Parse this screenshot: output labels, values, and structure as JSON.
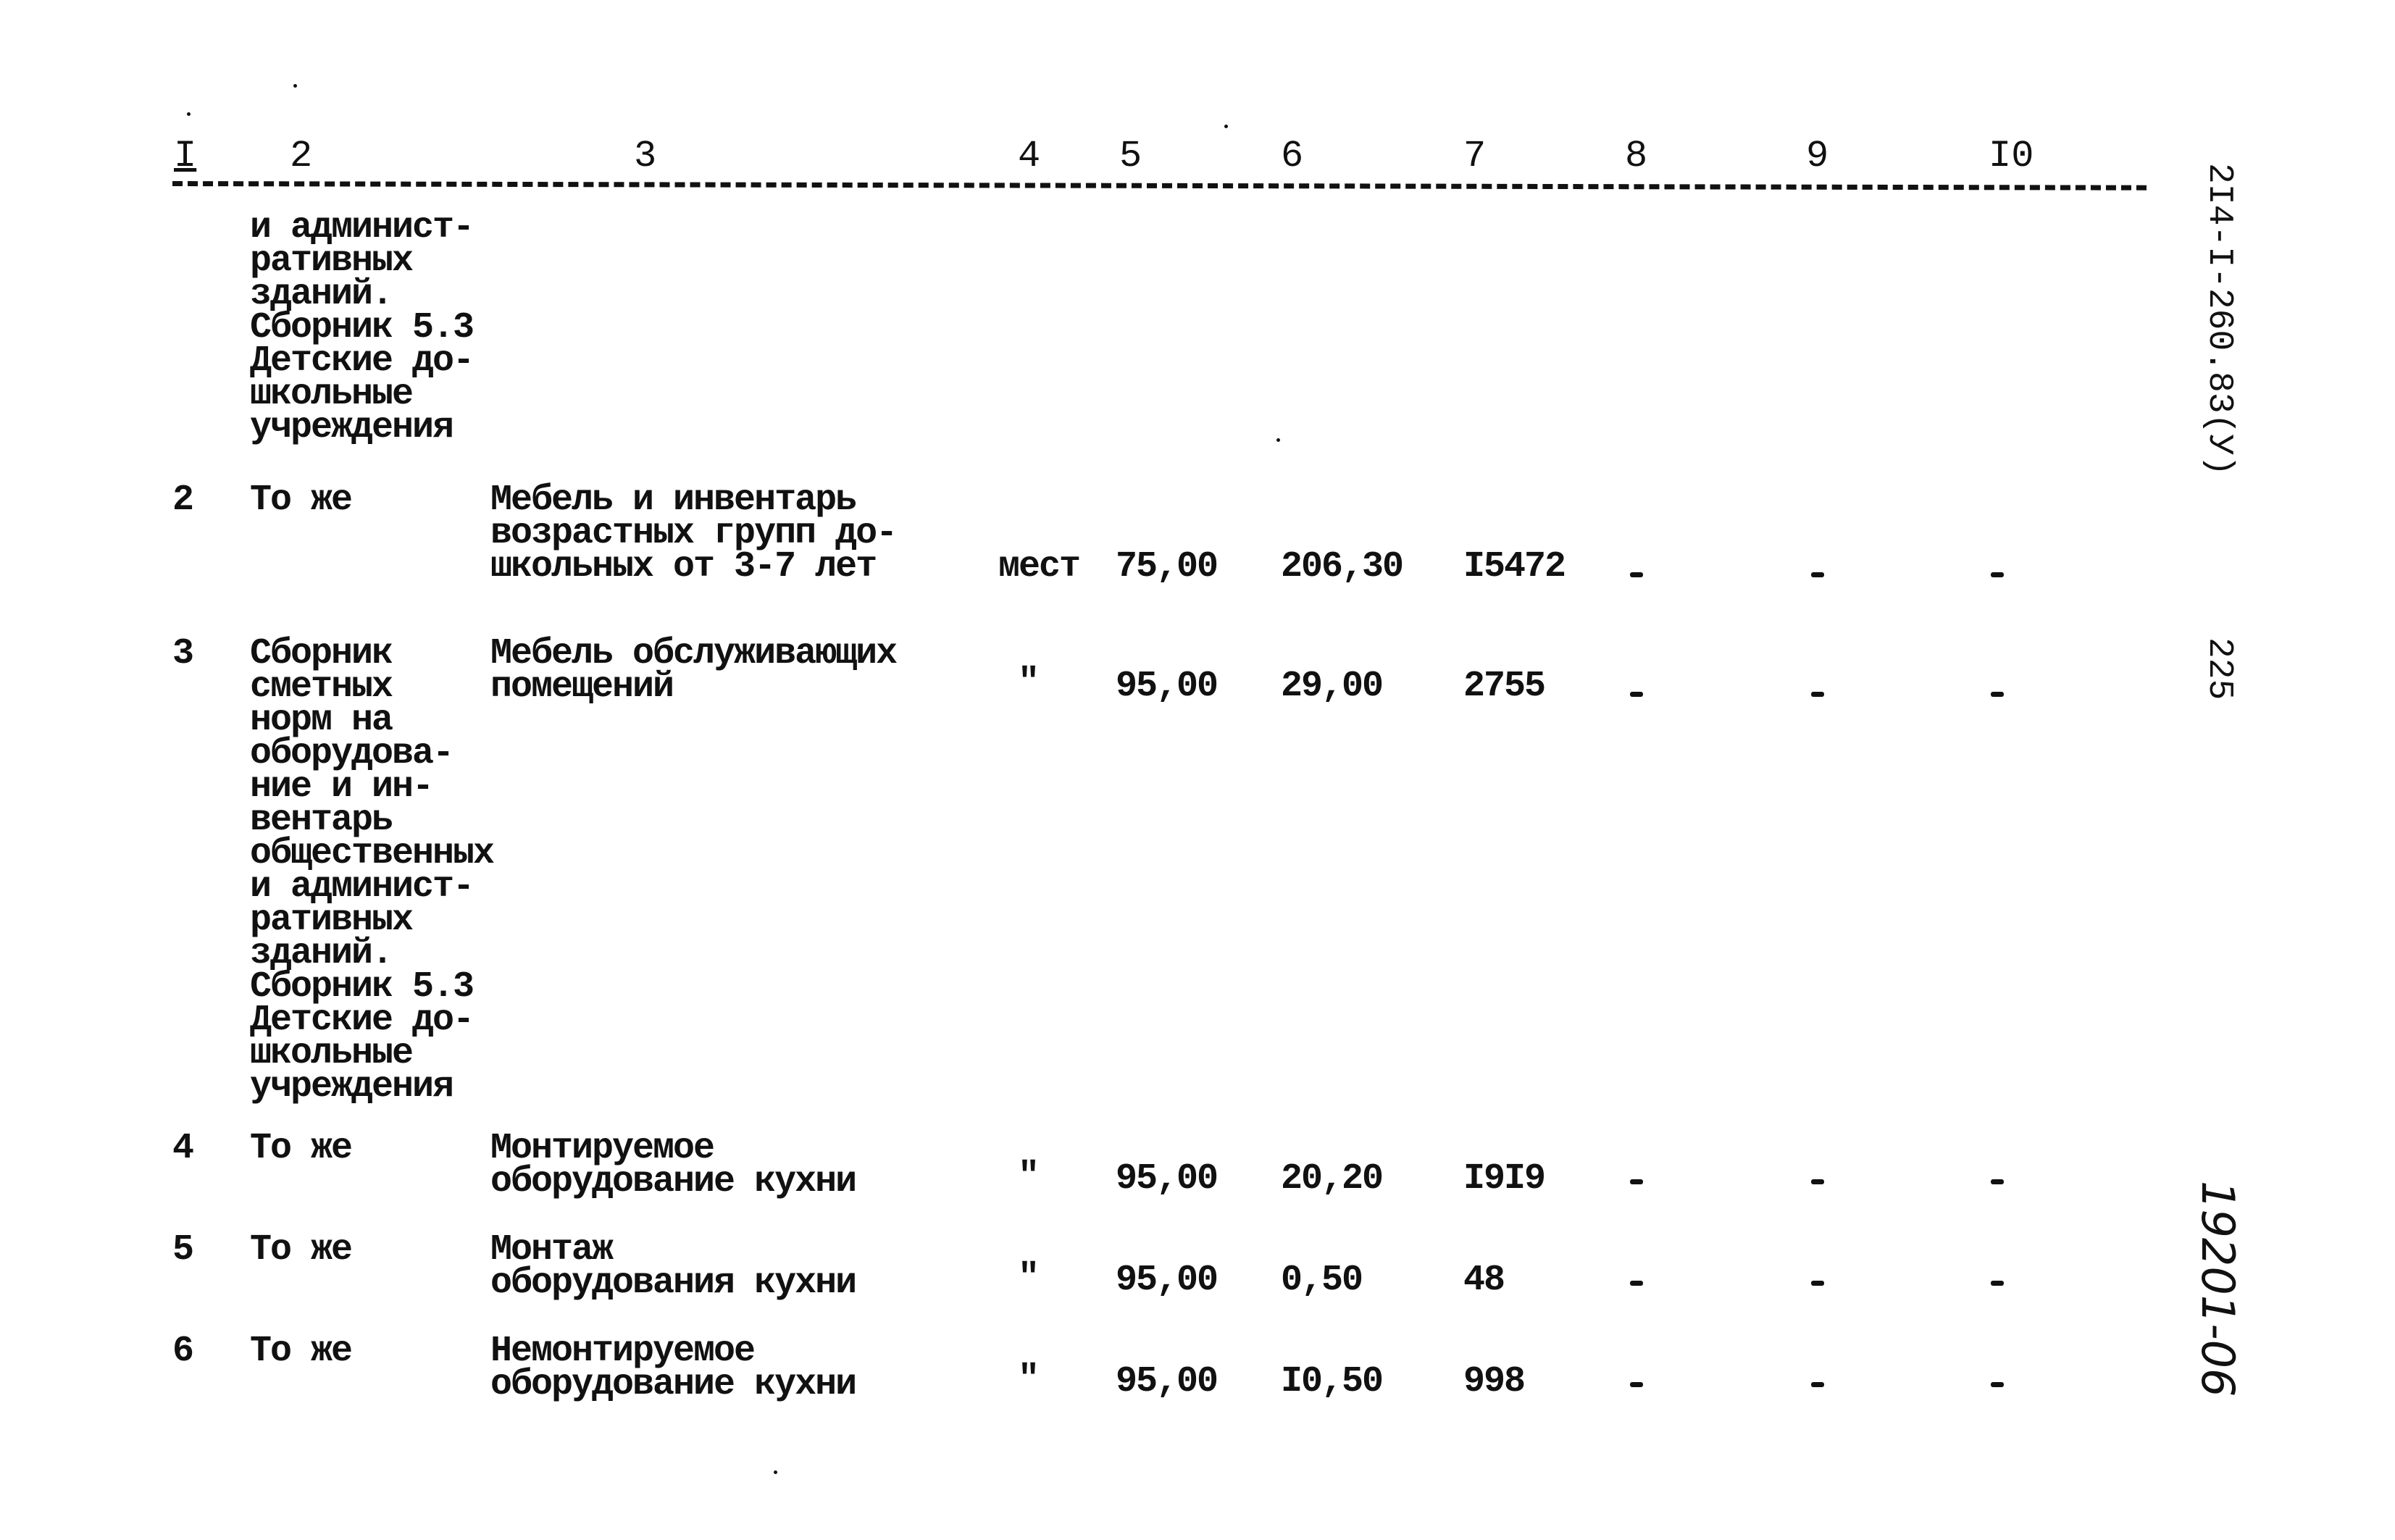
{
  "header": {
    "columns": [
      "I",
      "2",
      "3",
      "4",
      "5",
      "6",
      "7",
      "8",
      "9",
      "I0"
    ]
  },
  "margin": {
    "doc_code": "2I4-I-260.83(У)",
    "page_number": "225",
    "handwritten_code": "19201-06"
  },
  "rows": [
    {
      "num": "",
      "source": "и админист-\nративных\nзданий.\nСборник 5.3\nДетские до-\nшкольные\nучреждения",
      "name": "",
      "unit": "",
      "c5": "",
      "c6": "",
      "c7": "",
      "c8": "",
      "c9": "",
      "c10": ""
    },
    {
      "num": "2",
      "source": "То же",
      "name": "Мебель и инвентарь\nвозрастных групп до-\nшкольных от 3-7 лет",
      "unit": "мест",
      "c5": "75,00",
      "c6": "206,30",
      "c7": "I5472",
      "c8": "-",
      "c9": "-",
      "c10": "-"
    },
    {
      "num": "3",
      "source": "Сборник\nсметных\nнорм на\nоборудова-\nние и ин-\nвентарь\nобщественных\nи админист-\nративных\nзданий.\nСборник 5.3\nДетские до-\nшкольные\nучреждения",
      "name": "Мебель обслуживающих\nпомещений",
      "unit": "\"",
      "c5": "95,00",
      "c6": "29,00",
      "c7": "2755",
      "c8": "-",
      "c9": "-",
      "c10": "-"
    },
    {
      "num": "4",
      "source": "То же",
      "name": "Монтируемое\nоборудование кухни",
      "unit": "\"",
      "c5": "95,00",
      "c6": "20,20",
      "c7": "I9I9",
      "c8": "-",
      "c9": "-",
      "c10": "-"
    },
    {
      "num": "5",
      "source": "То же",
      "name": "Монтаж\nоборудования кухни",
      "unit": "\"",
      "c5": "95,00",
      "c6": "0,50",
      "c7": "48",
      "c8": "-",
      "c9": "-",
      "c10": "-"
    },
    {
      "num": "6",
      "source": "То же",
      "name": "Немонтируемое\nоборудование кухни",
      "unit": "\"",
      "c5": "95,00",
      "c6": "I0,50",
      "c7": "998",
      "c8": "-",
      "c9": "-",
      "c10": "-"
    }
  ]
}
